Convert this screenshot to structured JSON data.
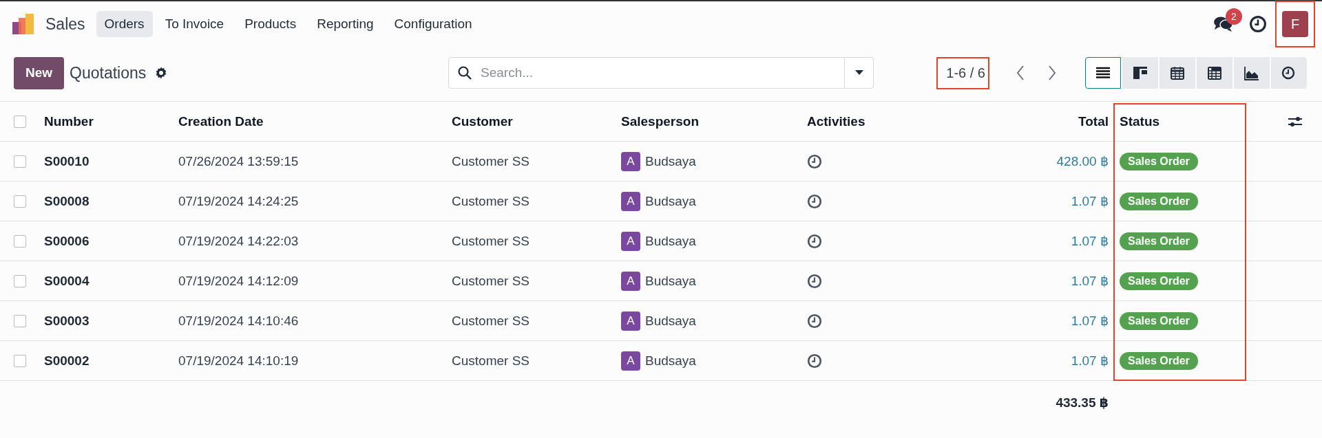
{
  "app": {
    "name": "Sales"
  },
  "menu": [
    {
      "label": "Orders",
      "selected": true
    },
    {
      "label": "To Invoice",
      "selected": false
    },
    {
      "label": "Products",
      "selected": false
    },
    {
      "label": "Reporting",
      "selected": false
    },
    {
      "label": "Configuration",
      "selected": false
    }
  ],
  "systray": {
    "messages_badge": "2",
    "user_initial": "F",
    "user_highlighted": true
  },
  "control_panel": {
    "new_button": "New",
    "title": "Quotations",
    "search": {
      "placeholder": "Search..."
    },
    "pager": {
      "text": "1-6 / 6",
      "highlighted": true
    },
    "views": [
      {
        "kind": "list",
        "selected": true
      },
      {
        "kind": "kanban",
        "selected": false
      },
      {
        "kind": "calendar",
        "selected": false
      },
      {
        "kind": "pivot",
        "selected": false
      },
      {
        "kind": "graph",
        "selected": false
      },
      {
        "kind": "activity",
        "selected": false
      }
    ]
  },
  "table": {
    "all_checked": false,
    "columns": [
      {
        "label": "Number",
        "kind": "text",
        "highlighted": false
      },
      {
        "label": "Creation Date",
        "kind": "text",
        "highlighted": false
      },
      {
        "label": "Customer",
        "kind": "text",
        "highlighted": false
      },
      {
        "label": "Salesperson",
        "kind": "text",
        "highlighted": false
      },
      {
        "label": "Activities",
        "kind": "text",
        "highlighted": false
      },
      {
        "label": "Total",
        "kind": "number",
        "highlighted": false
      },
      {
        "label": "Status",
        "kind": "text",
        "highlighted": true
      }
    ],
    "rows": [
      {
        "checked": false,
        "number": "S00010",
        "creation_date": "07/26/2024 13:59:15",
        "customer": "Customer SS",
        "salesperson": {
          "initial": "A",
          "name": "Budsaya"
        },
        "total": "428.00 ฿",
        "status": "Sales Order"
      },
      {
        "checked": false,
        "number": "S00008",
        "creation_date": "07/19/2024 14:24:25",
        "customer": "Customer SS",
        "salesperson": {
          "initial": "A",
          "name": "Budsaya"
        },
        "total": "1.07 ฿",
        "status": "Sales Order"
      },
      {
        "checked": false,
        "number": "S00006",
        "creation_date": "07/19/2024 14:22:03",
        "customer": "Customer SS",
        "salesperson": {
          "initial": "A",
          "name": "Budsaya"
        },
        "total": "1.07 ฿",
        "status": "Sales Order"
      },
      {
        "checked": false,
        "number": "S00004",
        "creation_date": "07/19/2024 14:12:09",
        "customer": "Customer SS",
        "salesperson": {
          "initial": "A",
          "name": "Budsaya"
        },
        "total": "1.07 ฿",
        "status": "Sales Order"
      },
      {
        "checked": false,
        "number": "S00003",
        "creation_date": "07/19/2024 14:10:46",
        "customer": "Customer SS",
        "salesperson": {
          "initial": "A",
          "name": "Budsaya"
        },
        "total": "1.07 ฿",
        "status": "Sales Order"
      },
      {
        "checked": false,
        "number": "S00002",
        "creation_date": "07/19/2024 14:10:19",
        "customer": "Customer SS",
        "salesperson": {
          "initial": "A",
          "name": "Budsaya"
        },
        "total": "1.07 ฿",
        "status": "Sales Order"
      }
    ],
    "footer_total": "433.35 ฿"
  }
}
